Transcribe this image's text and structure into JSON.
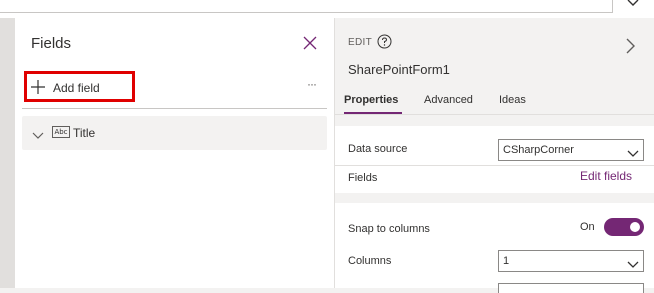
{
  "top": {
    "chevron_icon": "chevron-down-icon"
  },
  "fields_panel": {
    "title": "Fields",
    "close_icon": "close-icon",
    "add_field_label": "Add field",
    "more_icon": "ellipsis-icon",
    "items": [
      {
        "label": "Title",
        "type_badge": "Abc"
      }
    ]
  },
  "properties_panel": {
    "edit_label": "EDIT",
    "control_name": "SharePointForm1",
    "tabs": [
      {
        "label": "Properties",
        "active": true
      },
      {
        "label": "Advanced",
        "active": false
      },
      {
        "label": "Ideas",
        "active": false
      }
    ],
    "data_source": {
      "label": "Data source",
      "value": "CSharpCorner"
    },
    "fields": {
      "label": "Fields",
      "link": "Edit fields"
    },
    "snap_to_columns": {
      "label": "Snap to columns",
      "state": "On"
    },
    "columns": {
      "label": "Columns",
      "value": "1"
    }
  },
  "colors": {
    "accent": "#742774",
    "highlight_box": "#e00000"
  }
}
